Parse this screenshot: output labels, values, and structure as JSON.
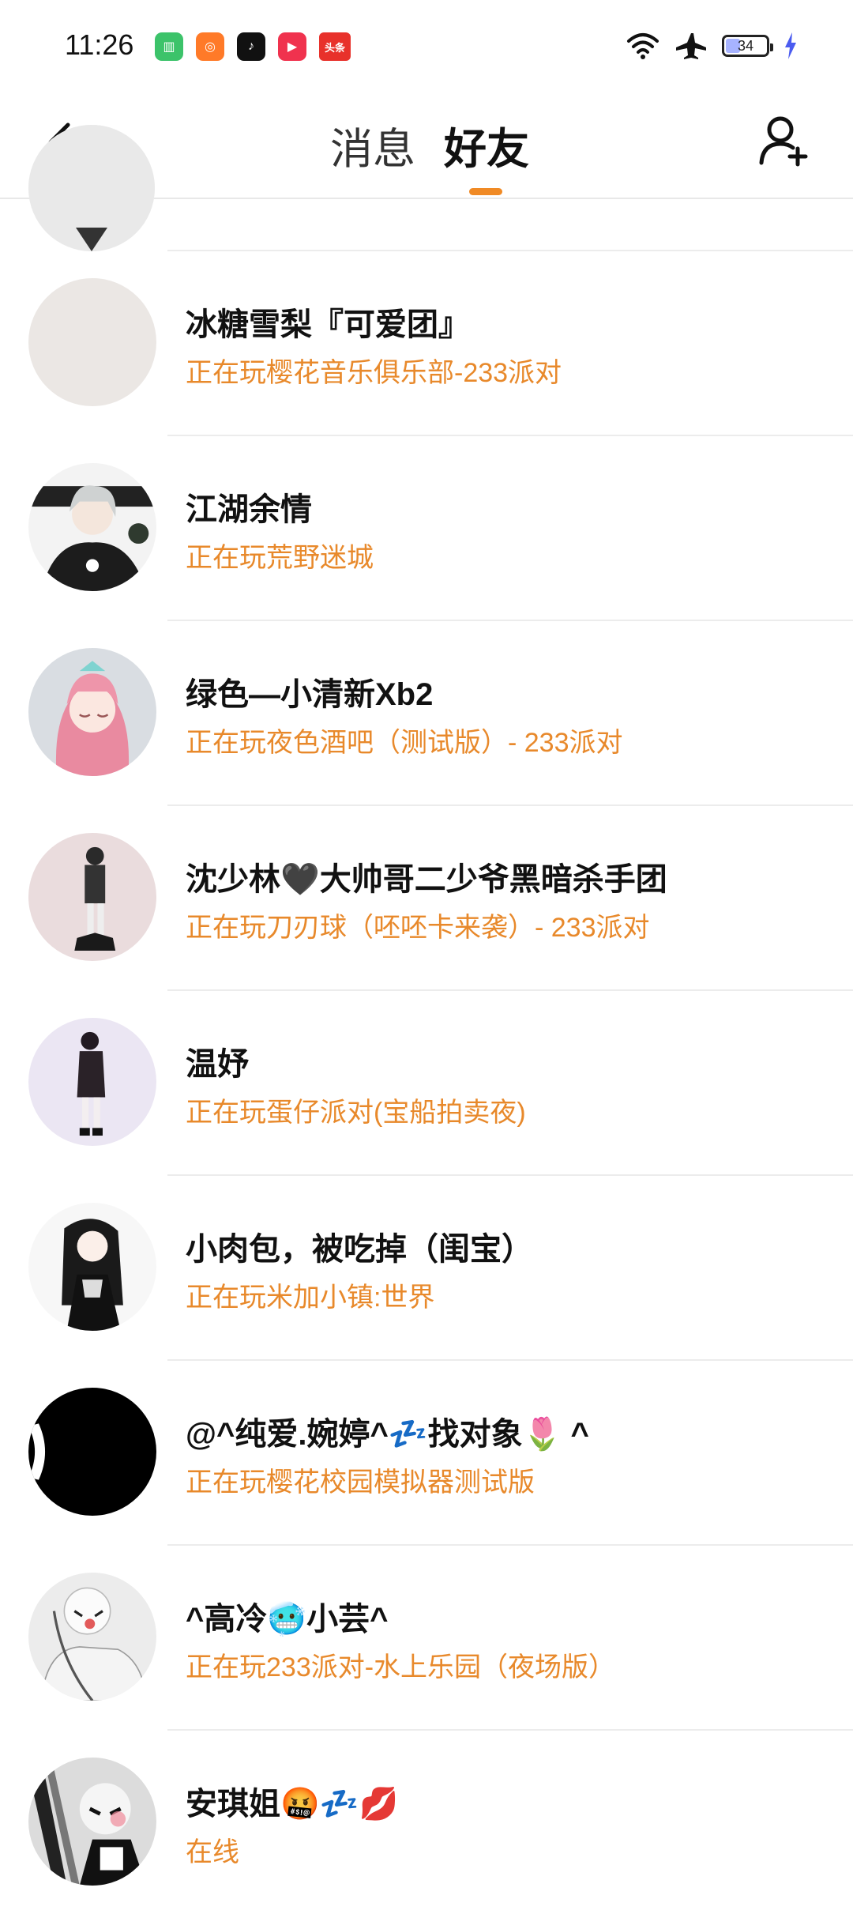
{
  "status_bar": {
    "time": "11:26",
    "app_icons": [
      {
        "name": "market-app-icon",
        "glyph": "▥",
        "color": "#3cc36a"
      },
      {
        "name": "video-app-icon",
        "glyph": "◎",
        "color": "#ff7a28"
      },
      {
        "name": "douyin-app-icon",
        "glyph": "♪",
        "color": "#111111"
      },
      {
        "name": "play-app-icon",
        "glyph": "▶",
        "color": "#f0324e"
      },
      {
        "name": "toutiao-app-icon",
        "glyph": "头条",
        "color": "#e8312b"
      }
    ],
    "battery": "34"
  },
  "header": {
    "tab_messages": "消息",
    "tab_friends": "好友",
    "accent": "#f08a25"
  },
  "friends": [
    {
      "name": "冰糖雪梨『可爱团』",
      "status": "正在玩樱花音乐俱乐部-233派对"
    },
    {
      "name": "江湖余情",
      "status": "正在玩荒野迷城"
    },
    {
      "name": "绿色—小清新Xb2",
      "status": "正在玩夜色酒吧（测试版）- 233派对"
    },
    {
      "name": "沈少林🖤大帅哥二少爷黑暗杀手团",
      "status": "正在玩刀刃球（呸呸卡来袭）- 233派对"
    },
    {
      "name": "温妤",
      "status": "正在玩蛋仔派对(宝船拍卖夜)"
    },
    {
      "name": "小肉包，被吃掉（闺宝）",
      "status": "正在玩米加小镇:世界"
    },
    {
      "name": "@^纯爱.婉婷^💤找对象🌷 ^",
      "status": "正在玩樱花校园模拟器测试版"
    },
    {
      "name": "^高冷🥶小芸^",
      "status": "正在玩233派对-水上乐园（夜场版）"
    },
    {
      "name": "安琪姐🤬💤💋",
      "status": "在线"
    }
  ]
}
